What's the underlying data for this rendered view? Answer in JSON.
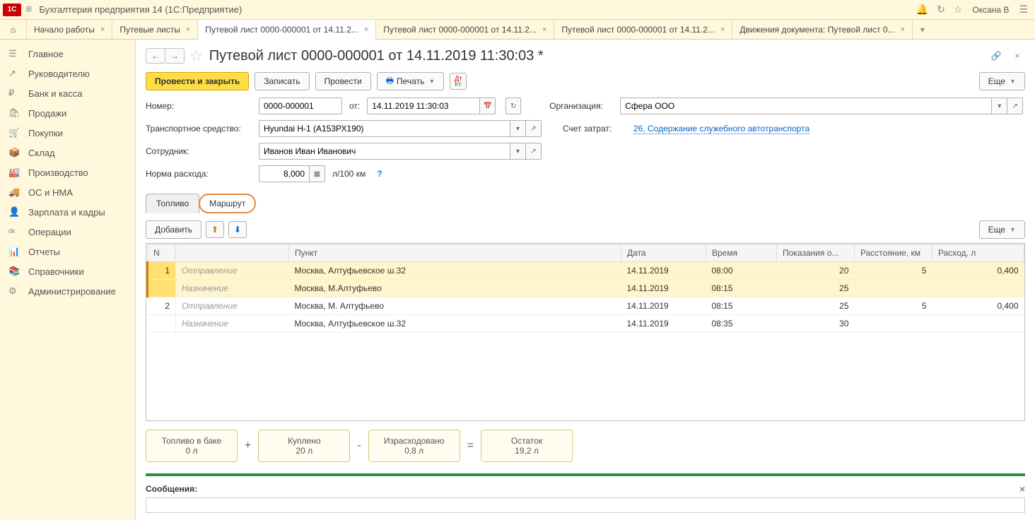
{
  "titlebar": {
    "title": "Бухгалтерия предприятия 14   (1С:Предприятие)",
    "user": "Оксана В"
  },
  "tabs": [
    {
      "label": "Начало работы"
    },
    {
      "label": "Путевые листы"
    },
    {
      "label": "Путевой лист 0000-000001 от 14.11.2...",
      "active": true
    },
    {
      "label": "Путевой лист 0000-000001 от 14.11.2..."
    },
    {
      "label": "Путевой лист 0000-000001 от 14.11.2..."
    },
    {
      "label": "Движения документа: Путевой лист 0..."
    }
  ],
  "sidebar": [
    {
      "icon": "☰",
      "label": "Главное"
    },
    {
      "icon": "↗",
      "label": "Руководителю"
    },
    {
      "icon": "₽",
      "label": "Банк и касса"
    },
    {
      "icon": "🛍",
      "label": "Продажи"
    },
    {
      "icon": "🛒",
      "label": "Покупки"
    },
    {
      "icon": "📦",
      "label": "Склад"
    },
    {
      "icon": "🏭",
      "label": "Производство"
    },
    {
      "icon": "🚚",
      "label": "ОС и НМА"
    },
    {
      "icon": "👤",
      "label": "Зарплата и кадры"
    },
    {
      "icon": "ᵈᵏ",
      "label": "Операции"
    },
    {
      "icon": "📊",
      "label": "Отчеты"
    },
    {
      "icon": "📚",
      "label": "Справочники"
    },
    {
      "icon": "⚙",
      "label": "Администрирование"
    }
  ],
  "doc": {
    "title": "Путевой лист 0000-000001 от 14.11.2019 11:30:03 *",
    "toolbar": {
      "post_close": "Провести и закрыть",
      "save": "Записать",
      "post": "Провести",
      "print": "Печать",
      "more": "Еще"
    },
    "form": {
      "number_label": "Номер:",
      "number": "0000-000001",
      "date_label": "от:",
      "date": "14.11.2019 11:30:03",
      "org_label": "Организация:",
      "org": "Сфера ООО",
      "vehicle_label": "Транспортное средство:",
      "vehicle": "Hyundai H-1 (А153РХ190)",
      "cost_acc_label": "Счет затрат:",
      "cost_acc_link": "26, Содержание служебного автотранспорта",
      "employee_label": "Сотрудник:",
      "employee": "Иванов Иван Иванович",
      "rate_label": "Норма расхода:",
      "rate": "8,000",
      "rate_unit": "л/100 км"
    },
    "inner_tabs": {
      "fuel": "Топливо",
      "route": "Маршрут"
    },
    "route_toolbar": {
      "add": "Добавить",
      "more": "Еще"
    },
    "route_table": {
      "headers": {
        "n": "N",
        "point": "Пункт",
        "date": "Дата",
        "time": "Время",
        "odo": "Показания о...",
        "dist": "Расстояние, км",
        "cons": "Расход, л"
      },
      "row_types": {
        "departure": "Отправление",
        "destination": "Назначение"
      },
      "rows": [
        {
          "n": "1",
          "selected": true,
          "dep_point": "Москва, Алтуфьевское ш.32",
          "dep_date": "14.11.2019",
          "dep_time": "08:00",
          "dep_odo": "20",
          "dist": "5",
          "cons": "0,400",
          "dst_point": "Москва, М.Алтуфьево",
          "dst_date": "14.11.2019",
          "dst_time": "08:15",
          "dst_odo": "25"
        },
        {
          "n": "2",
          "selected": false,
          "dep_point": "Москва, М.  Алтуфьево",
          "dep_date": "14.11.2019",
          "dep_time": "08:15",
          "dep_odo": "25",
          "dist": "5",
          "cons": "0,400",
          "dst_point": "Москва, Алтуфьевское ш.32",
          "dst_date": "14.11.2019",
          "dst_time": "08:35",
          "dst_odo": "30"
        }
      ]
    },
    "fuel_summary": {
      "tank": {
        "label": "Топливо в баке",
        "value": "0 л"
      },
      "bought": {
        "label": "Куплено",
        "value": "20 л"
      },
      "spent": {
        "label": "Израсходовано",
        "value": "0,8 л"
      },
      "remain": {
        "label": "Остаток",
        "value": "19,2 л"
      }
    },
    "messages_label": "Сообщения:"
  }
}
